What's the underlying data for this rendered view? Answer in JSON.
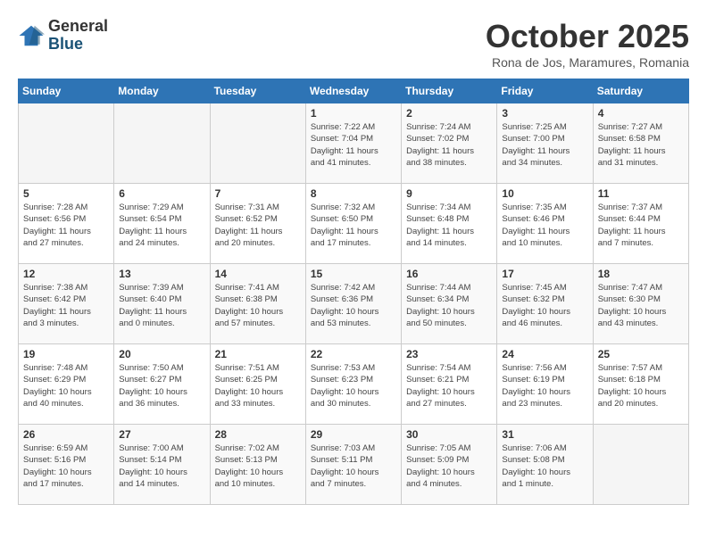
{
  "logo": {
    "general": "General",
    "blue": "Blue"
  },
  "title": "October 2025",
  "subtitle": "Rona de Jos, Maramures, Romania",
  "days_of_week": [
    "Sunday",
    "Monday",
    "Tuesday",
    "Wednesday",
    "Thursday",
    "Friday",
    "Saturday"
  ],
  "weeks": [
    [
      {
        "day": "",
        "info": ""
      },
      {
        "day": "",
        "info": ""
      },
      {
        "day": "",
        "info": ""
      },
      {
        "day": "1",
        "info": "Sunrise: 7:22 AM\nSunset: 7:04 PM\nDaylight: 11 hours\nand 41 minutes."
      },
      {
        "day": "2",
        "info": "Sunrise: 7:24 AM\nSunset: 7:02 PM\nDaylight: 11 hours\nand 38 minutes."
      },
      {
        "day": "3",
        "info": "Sunrise: 7:25 AM\nSunset: 7:00 PM\nDaylight: 11 hours\nand 34 minutes."
      },
      {
        "day": "4",
        "info": "Sunrise: 7:27 AM\nSunset: 6:58 PM\nDaylight: 11 hours\nand 31 minutes."
      }
    ],
    [
      {
        "day": "5",
        "info": "Sunrise: 7:28 AM\nSunset: 6:56 PM\nDaylight: 11 hours\nand 27 minutes."
      },
      {
        "day": "6",
        "info": "Sunrise: 7:29 AM\nSunset: 6:54 PM\nDaylight: 11 hours\nand 24 minutes."
      },
      {
        "day": "7",
        "info": "Sunrise: 7:31 AM\nSunset: 6:52 PM\nDaylight: 11 hours\nand 20 minutes."
      },
      {
        "day": "8",
        "info": "Sunrise: 7:32 AM\nSunset: 6:50 PM\nDaylight: 11 hours\nand 17 minutes."
      },
      {
        "day": "9",
        "info": "Sunrise: 7:34 AM\nSunset: 6:48 PM\nDaylight: 11 hours\nand 14 minutes."
      },
      {
        "day": "10",
        "info": "Sunrise: 7:35 AM\nSunset: 6:46 PM\nDaylight: 11 hours\nand 10 minutes."
      },
      {
        "day": "11",
        "info": "Sunrise: 7:37 AM\nSunset: 6:44 PM\nDaylight: 11 hours\nand 7 minutes."
      }
    ],
    [
      {
        "day": "12",
        "info": "Sunrise: 7:38 AM\nSunset: 6:42 PM\nDaylight: 11 hours\nand 3 minutes."
      },
      {
        "day": "13",
        "info": "Sunrise: 7:39 AM\nSunset: 6:40 PM\nDaylight: 11 hours\nand 0 minutes."
      },
      {
        "day": "14",
        "info": "Sunrise: 7:41 AM\nSunset: 6:38 PM\nDaylight: 10 hours\nand 57 minutes."
      },
      {
        "day": "15",
        "info": "Sunrise: 7:42 AM\nSunset: 6:36 PM\nDaylight: 10 hours\nand 53 minutes."
      },
      {
        "day": "16",
        "info": "Sunrise: 7:44 AM\nSunset: 6:34 PM\nDaylight: 10 hours\nand 50 minutes."
      },
      {
        "day": "17",
        "info": "Sunrise: 7:45 AM\nSunset: 6:32 PM\nDaylight: 10 hours\nand 46 minutes."
      },
      {
        "day": "18",
        "info": "Sunrise: 7:47 AM\nSunset: 6:30 PM\nDaylight: 10 hours\nand 43 minutes."
      }
    ],
    [
      {
        "day": "19",
        "info": "Sunrise: 7:48 AM\nSunset: 6:29 PM\nDaylight: 10 hours\nand 40 minutes."
      },
      {
        "day": "20",
        "info": "Sunrise: 7:50 AM\nSunset: 6:27 PM\nDaylight: 10 hours\nand 36 minutes."
      },
      {
        "day": "21",
        "info": "Sunrise: 7:51 AM\nSunset: 6:25 PM\nDaylight: 10 hours\nand 33 minutes."
      },
      {
        "day": "22",
        "info": "Sunrise: 7:53 AM\nSunset: 6:23 PM\nDaylight: 10 hours\nand 30 minutes."
      },
      {
        "day": "23",
        "info": "Sunrise: 7:54 AM\nSunset: 6:21 PM\nDaylight: 10 hours\nand 27 minutes."
      },
      {
        "day": "24",
        "info": "Sunrise: 7:56 AM\nSunset: 6:19 PM\nDaylight: 10 hours\nand 23 minutes."
      },
      {
        "day": "25",
        "info": "Sunrise: 7:57 AM\nSunset: 6:18 PM\nDaylight: 10 hours\nand 20 minutes."
      }
    ],
    [
      {
        "day": "26",
        "info": "Sunrise: 6:59 AM\nSunset: 5:16 PM\nDaylight: 10 hours\nand 17 minutes."
      },
      {
        "day": "27",
        "info": "Sunrise: 7:00 AM\nSunset: 5:14 PM\nDaylight: 10 hours\nand 14 minutes."
      },
      {
        "day": "28",
        "info": "Sunrise: 7:02 AM\nSunset: 5:13 PM\nDaylight: 10 hours\nand 10 minutes."
      },
      {
        "day": "29",
        "info": "Sunrise: 7:03 AM\nSunset: 5:11 PM\nDaylight: 10 hours\nand 7 minutes."
      },
      {
        "day": "30",
        "info": "Sunrise: 7:05 AM\nSunset: 5:09 PM\nDaylight: 10 hours\nand 4 minutes."
      },
      {
        "day": "31",
        "info": "Sunrise: 7:06 AM\nSunset: 5:08 PM\nDaylight: 10 hours\nand 1 minute."
      },
      {
        "day": "",
        "info": ""
      }
    ]
  ]
}
